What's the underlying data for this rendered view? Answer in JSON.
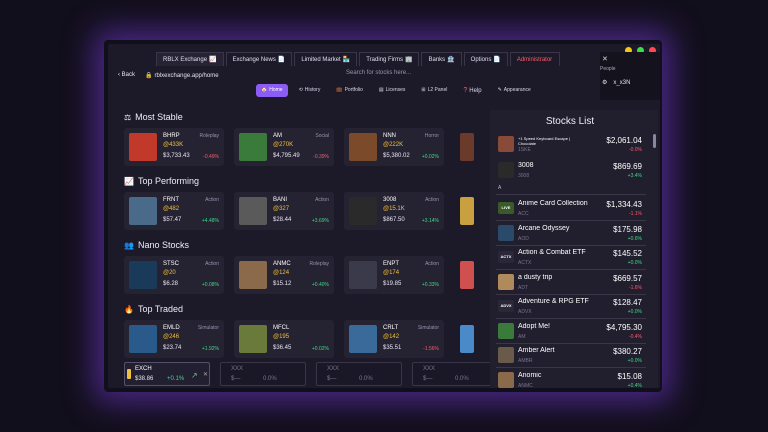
{
  "tabs": [
    {
      "label": "RBLX Exchange",
      "icon": "📈",
      "active": true
    },
    {
      "label": "Exchange News",
      "icon": "📄"
    },
    {
      "label": "Limited Market",
      "icon": "🏪"
    },
    {
      "label": "Trading Firms",
      "icon": "🏢"
    },
    {
      "label": "Banks",
      "icon": "🏦"
    },
    {
      "label": "Options",
      "icon": "📄"
    },
    {
      "label": "Administrator",
      "icon": ""
    }
  ],
  "window_controls": {
    "yellow": "#f5c518",
    "green": "#3ddc4a",
    "red": "#ff4a55"
  },
  "people": {
    "close": "✕",
    "title": "People",
    "user": "x_x3N"
  },
  "address": {
    "back": "‹ Back",
    "url": "rblxexchange.app/home",
    "search_placeholder": "Search for stocks here..."
  },
  "nav": [
    {
      "label": "Home",
      "icon": "🏠",
      "active": true
    },
    {
      "label": "History",
      "icon": "⟲"
    },
    {
      "label": "Portfolio",
      "icon": "💼"
    },
    {
      "label": "Licenses",
      "icon": "▤"
    },
    {
      "label": "L2 Panel",
      "icon": "⊞"
    },
    {
      "label": "Help",
      "icon": "?"
    },
    {
      "label": "Appearance",
      "icon": "✎"
    }
  ],
  "sections": [
    {
      "title": "Most Stable",
      "icon": "⚖",
      "cards": [
        {
          "ticker": "BHRP",
          "genre": "Roleplay",
          "volume": "@433K",
          "price": "$3,733.43",
          "change": "-0.49%",
          "dir": "neg",
          "color": "#c0392b"
        },
        {
          "ticker": "AM",
          "genre": "Social",
          "volume": "@270K",
          "price": "$4,795.49",
          "change": "-0.39%",
          "dir": "neg",
          "color": "#3a7a3a"
        },
        {
          "ticker": "NNN",
          "genre": "Horror",
          "volume": "@222K",
          "price": "$5,380.02",
          "change": "+0.02%",
          "dir": "pos",
          "color": "#7a4a2a"
        }
      ]
    },
    {
      "title": "Top Performing",
      "icon": "📈",
      "cards": [
        {
          "ticker": "FRNT",
          "genre": "Action",
          "volume": "@482",
          "price": "$57.47",
          "change": "+4.48%",
          "dir": "pos",
          "color": "#4a6a8a"
        },
        {
          "ticker": "BANI",
          "genre": "Action",
          "volume": "@327",
          "price": "$28.44",
          "change": "+3.69%",
          "dir": "pos",
          "color": "#5a5a5a"
        },
        {
          "ticker": "3008",
          "genre": "Action",
          "volume": "@15.1K",
          "price": "$867.50",
          "change": "+3.14%",
          "dir": "pos",
          "color": "#2a2a2a"
        }
      ]
    },
    {
      "title": "Nano Stocks",
      "icon": "👥",
      "cards": [
        {
          "ticker": "STSC",
          "genre": "Action",
          "volume": "@20",
          "price": "$6.28",
          "change": "+0.08%",
          "dir": "pos",
          "color": "#1a3a5a"
        },
        {
          "ticker": "ANMC",
          "genre": "Roleplay",
          "volume": "@124",
          "price": "$15.12",
          "change": "+0.40%",
          "dir": "pos",
          "color": "#8a6a4a"
        },
        {
          "ticker": "ENPT",
          "genre": "Action",
          "volume": "@174",
          "price": "$19.85",
          "change": "+0.33%",
          "dir": "pos",
          "color": "#3a3a4a"
        }
      ]
    },
    {
      "title": "Top Traded",
      "icon": "🔥",
      "cards": [
        {
          "ticker": "EMLD",
          "genre": "Simulator",
          "volume": "@246",
          "price": "$23.74",
          "change": "+1.92%",
          "dir": "pos",
          "color": "#2a5a8a"
        },
        {
          "ticker": "MFCL",
          "genre": "",
          "volume": "@195",
          "price": "$36.45",
          "change": "+0.02%",
          "dir": "pos",
          "color": "#6a7a3a"
        },
        {
          "ticker": "CRLT",
          "genre": "Simulator",
          "volume": "@142",
          "price": "$35.51",
          "change": "-1.56%",
          "dir": "neg",
          "color": "#3a6a9a"
        }
      ]
    }
  ],
  "ticker_bar": [
    {
      "name": "EXCH",
      "price": "$38.86",
      "change": "+0.1%",
      "selected": true
    },
    {
      "name": "XXX",
      "price": "$—",
      "change": "0.0%"
    },
    {
      "name": "XXX",
      "price": "$—",
      "change": "0.0%"
    },
    {
      "name": "XXX",
      "price": "$—",
      "change": "0.0%"
    }
  ],
  "stocks_list": {
    "title": "Stocks List",
    "letter_a": "A",
    "top": [
      {
        "name": "+1 Speed Keyboard Escape | Chocolate",
        "ticker": "1SKE",
        "price": "$2,061.04",
        "change": "-0.0%",
        "dir": "neg",
        "color": "#8a4a3a",
        "small": true
      },
      {
        "name": "3008",
        "ticker": "3008",
        "price": "$869.69",
        "change": "+3.4%",
        "dir": "pos",
        "color": "#2a2a2a"
      }
    ],
    "rows": [
      {
        "name": "Anime Card Collection",
        "ticker": "ACC",
        "price": "$1,334.43",
        "change": "-1.1%",
        "dir": "neg",
        "color": "#3a5a2a",
        "tag": "LIVE"
      },
      {
        "name": "Arcane Odyssey",
        "ticker": "AOD",
        "price": "$175.98",
        "change": "+0.6%",
        "dir": "pos",
        "color": "#2a4a6a"
      },
      {
        "name": "Action & Combat ETF",
        "ticker": "ACTX",
        "price": "$145.52",
        "change": "+0.0%",
        "dir": "pos",
        "color": "#2a2838",
        "tag": "ACTX"
      },
      {
        "name": "a dusty trip",
        "ticker": "ADT",
        "price": "$669.57",
        "change": "-1.6%",
        "dir": "neg",
        "color": "#b08a5a"
      },
      {
        "name": "Adventure & RPG ETF",
        "ticker": "ADVX",
        "price": "$128.47",
        "change": "+0.0%",
        "dir": "pos",
        "color": "#2a2838",
        "tag": "ADVX"
      },
      {
        "name": "Adopt Me!",
        "ticker": "AM",
        "price": "$4,795.30",
        "change": "-0.4%",
        "dir": "neg",
        "color": "#3a7a3a"
      },
      {
        "name": "Amber Alert",
        "ticker": "AMBR",
        "price": "$380.27",
        "change": "+0.0%",
        "dir": "pos",
        "color": "#6a5a4a"
      },
      {
        "name": "Anomic",
        "ticker": "ANMC",
        "price": "$15.08",
        "change": "+0.4%",
        "dir": "pos",
        "color": "#8a6a4a"
      }
    ]
  }
}
